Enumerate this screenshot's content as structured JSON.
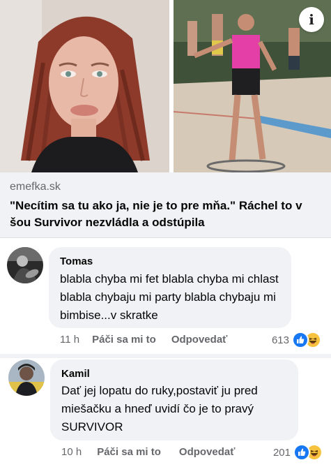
{
  "link_preview": {
    "domain": "emefka.sk",
    "headline": "\"Necítim sa tu ako ja, nie je to pre mňa.\" Ráchel to v šou Survivor nezvládla a odstúpila",
    "info_icon": "info-icon",
    "info_glyph": "i"
  },
  "comments": [
    {
      "author": "Tomas",
      "text": "blabla chyba mi fet blabla chyba mi chlast blabla chybaju mi party blabla chybaju mi bimbise...v skratke",
      "time": "11 h",
      "like_label": "Páči sa mi to",
      "reply_label": "Odpovedať",
      "reaction_count": "613",
      "reactions": [
        "like-icon",
        "haha-icon"
      ]
    },
    {
      "author": "Kamil",
      "text": "Dať jej lopatu do ruky,postaviť ju pred miešačku a hneď uvidí čo je to pravý SURVIVOR",
      "time": "10 h",
      "like_label": "Páči sa mi to",
      "reply_label": "Odpovedať",
      "reaction_count": "201",
      "reactions": [
        "like-icon",
        "haha-icon"
      ]
    }
  ],
  "colors": {
    "bubble": "#f0f2f5",
    "meta_text": "#65676b",
    "like_blue": "#1877f2",
    "haha_yellow": "#f7c33e"
  }
}
